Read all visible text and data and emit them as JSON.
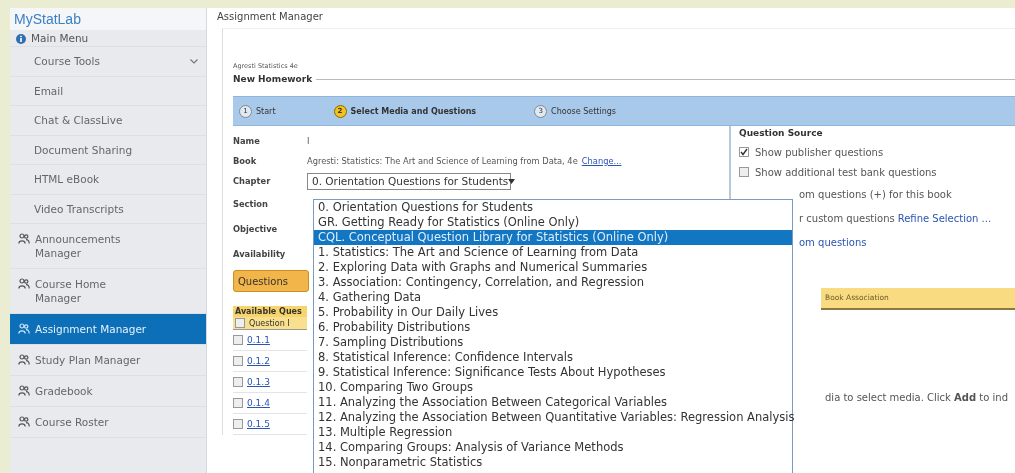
{
  "sidebar": {
    "logo": "MyStatLab",
    "items": [
      {
        "label": "Main Menu",
        "kind": "header",
        "selected": false
      },
      {
        "label": "Course Tools",
        "kind": "submenu",
        "selected": false
      },
      {
        "label": "Email",
        "kind": "sub",
        "selected": false
      },
      {
        "label": "Chat & ClassLive",
        "kind": "sub",
        "selected": false
      },
      {
        "label": "Document Sharing",
        "kind": "sub",
        "selected": false
      },
      {
        "label": "HTML eBook",
        "kind": "sub",
        "selected": false
      },
      {
        "label": "Video Transcripts",
        "kind": "sub",
        "selected": false
      },
      {
        "label": "Announcements Manager",
        "kind": "manager",
        "selected": false
      },
      {
        "label": "Course Home Manager",
        "kind": "manager",
        "selected": false
      },
      {
        "label": "Assignment Manager",
        "kind": "manager",
        "selected": true
      },
      {
        "label": "Study Plan Manager",
        "kind": "manager",
        "selected": false
      },
      {
        "label": "Gradebook",
        "kind": "manager",
        "selected": false
      },
      {
        "label": "Course Roster",
        "kind": "manager",
        "selected": false
      }
    ]
  },
  "page_title": "Assignment Manager",
  "course": "Agresti Statistics 4e",
  "heading": "New Homework",
  "steps": [
    {
      "number": "1",
      "label": "Start",
      "selected": false
    },
    {
      "number": "2",
      "label": "Select Media and Questions",
      "selected": true
    },
    {
      "number": "3",
      "label": "Choose Settings",
      "selected": false
    }
  ],
  "form": {
    "name_label": "Name",
    "name_value": "I",
    "book_label": "Book",
    "book_value": "Agresti: Statistics: The Art and Science of Learning from Data, 4e",
    "book_link": "Change...",
    "chapter_label": "Chapter",
    "chapter_value": "0. Orientation Questions for Students",
    "section_label": "Section",
    "objective_label": "Objective",
    "availability_label": "Availability"
  },
  "chapter_options": [
    {
      "label": "0. Orientation Questions for Students",
      "selected": false
    },
    {
      "label": "GR. Getting Ready for Statistics (Online Only)",
      "selected": false
    },
    {
      "label": "CQL. Conceptual Question Library for Statistics (Online Only)",
      "selected": true
    },
    {
      "label": "1. Statistics: The Art and Science of Learning from Data",
      "selected": false
    },
    {
      "label": "2. Exploring Data with Graphs and Numerical Summaries",
      "selected": false
    },
    {
      "label": "3. Association: Contingency, Correlation, and Regression",
      "selected": false
    },
    {
      "label": "4. Gathering Data",
      "selected": false
    },
    {
      "label": "5. Probability in Our Daily Lives",
      "selected": false
    },
    {
      "label": "6. Probability Distributions",
      "selected": false
    },
    {
      "label": "7. Sampling Distributions",
      "selected": false
    },
    {
      "label": "8. Statistical Inference: Confidence Intervals",
      "selected": false
    },
    {
      "label": "9. Statistical Inference: Significance Tests About Hypotheses",
      "selected": false
    },
    {
      "label": "10. Comparing Two Groups",
      "selected": false
    },
    {
      "label": "11. Analyzing the Association Between Categorical Variables",
      "selected": false
    },
    {
      "label": "12. Analyzing the Association Between Quantitative Variables: Regression Analysis",
      "selected": false
    },
    {
      "label": "13. Multiple Regression",
      "selected": false
    },
    {
      "label": "14. Comparing Groups: Analysis of Variance Methods",
      "selected": false
    },
    {
      "label": "15. Nonparametric Statistics",
      "selected": false
    }
  ],
  "question_source": {
    "title": "Question Source",
    "options": [
      {
        "label": "Show publisher questions",
        "checked": true
      },
      {
        "label": "Show additional test bank questions",
        "checked": false
      }
    ],
    "partial_line_1": "om questions (+) for this book",
    "partial_line_2": "r custom questions",
    "refine_link": "Refine Selection ...",
    "partial_link": "om questions"
  },
  "questions_button": "Questions",
  "available_header": "Available Ques",
  "question_column": "Question I",
  "question_rows": [
    {
      "id": "0.1.1",
      "checked": false
    },
    {
      "id": "0.1.2",
      "checked": false
    },
    {
      "id": "0.1.3",
      "checked": false
    },
    {
      "id": "0.1.4",
      "checked": false
    },
    {
      "id": "0.1.5",
      "checked": false
    }
  ],
  "book_association_header": "Book Association",
  "hint": "dia to select media. Click **Add** to ind"
}
